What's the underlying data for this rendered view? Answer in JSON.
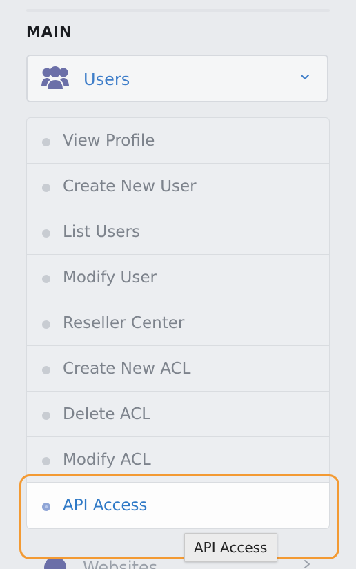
{
  "sidebar": {
    "section_heading": "MAIN",
    "users_menu": {
      "label": "Users",
      "icon": "users-group-icon",
      "expanded": true,
      "items": [
        {
          "label": "View Profile"
        },
        {
          "label": "Create New User"
        },
        {
          "label": "List Users"
        },
        {
          "label": "Modify User"
        },
        {
          "label": "Reseller Center"
        },
        {
          "label": "Create New ACL"
        },
        {
          "label": "Delete ACL"
        },
        {
          "label": "Modify ACL"
        },
        {
          "label": "API Access",
          "active": true
        }
      ]
    },
    "next_menu": {
      "label": "Websites",
      "icon": "globe-icon"
    }
  },
  "tooltip": {
    "text": "API Access"
  },
  "colors": {
    "accent": "#2f79c6",
    "highlight": "#f39a33",
    "icon_purple": "#6b6fa8"
  }
}
